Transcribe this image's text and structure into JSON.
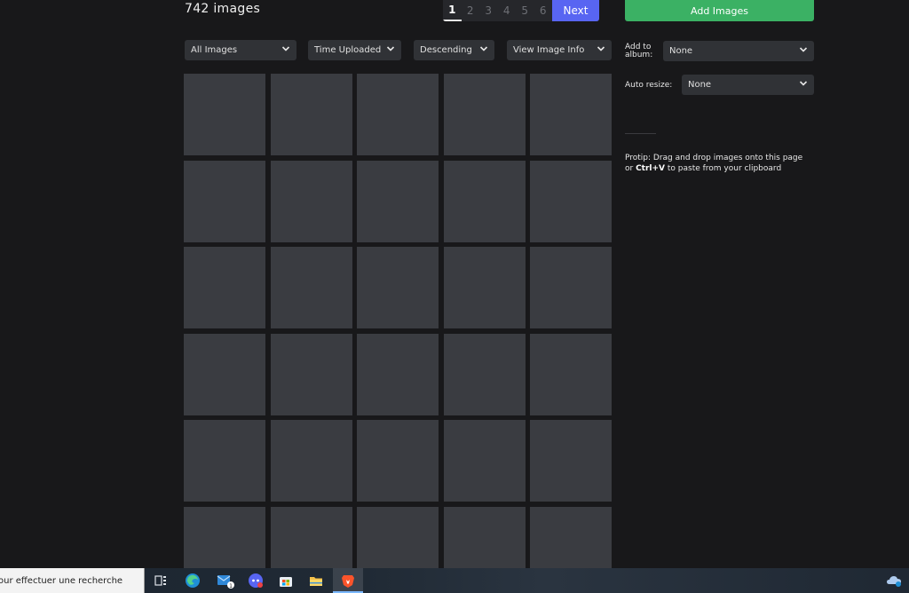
{
  "header": {
    "image_count": "742 images",
    "pagination": {
      "pages": [
        "1",
        "2",
        "3",
        "4",
        "5",
        "6"
      ],
      "current": "1",
      "next_label": "Next"
    },
    "add_images_label": "Add Images"
  },
  "filters": {
    "type": "All Images",
    "sort_by": "Time Uploaded",
    "order": "Descending",
    "view": "View Image Info"
  },
  "sidebar": {
    "album_label": "Add to album:",
    "album_value": "None",
    "resize_label": "Auto resize:",
    "resize_value": "None",
    "protip_prefix": "Protip: Drag and drop images onto this page or ",
    "protip_shortcut": "Ctrl+V",
    "protip_suffix": " to paste from your clipboard"
  },
  "grid": {
    "thumbnail_count": 30
  },
  "taskbar": {
    "search_text": "our effectuer une recherche",
    "mail_badge": "1",
    "icons": [
      "task-view-icon",
      "edge-icon",
      "mail-icon",
      "discord-icon",
      "store-icon",
      "file-explorer-icon",
      "brave-icon",
      "onedrive-icon"
    ]
  },
  "colors": {
    "background": "#18181a",
    "accent_next": "#5865f2",
    "accent_add": "#3bb164",
    "thumbnail": "#3a3c41"
  }
}
